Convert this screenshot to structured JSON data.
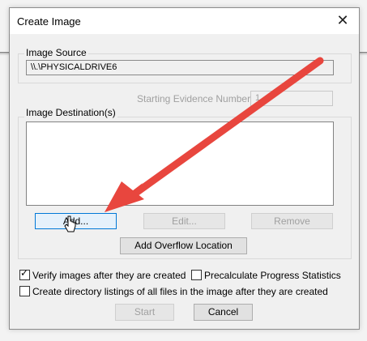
{
  "window": {
    "title": "Create Image",
    "close_glyph": "✕"
  },
  "image_source": {
    "label": "Image Source",
    "value": "\\\\.\\PHYSICALDRIVE6",
    "starting_evidence_label": "Starting Evidence Number:",
    "starting_evidence_value": "1"
  },
  "destination": {
    "label": "Image Destination(s)",
    "buttons": {
      "add": "Add...",
      "edit": "Edit...",
      "remove": "Remove"
    },
    "overflow_button": "Add Overflow Location"
  },
  "options": {
    "verify": {
      "label": "Verify images after they are created",
      "checked": true
    },
    "precalc": {
      "label": "Precalculate Progress Statistics",
      "checked": false
    },
    "dirlist": {
      "label": "Create directory listings of all files in the image after they are created",
      "checked": false
    }
  },
  "footer": {
    "start": "Start",
    "cancel": "Cancel"
  },
  "colors": {
    "arrow": "#e8463e",
    "accent": "#0078d7"
  },
  "icons": {
    "check": "✓"
  }
}
